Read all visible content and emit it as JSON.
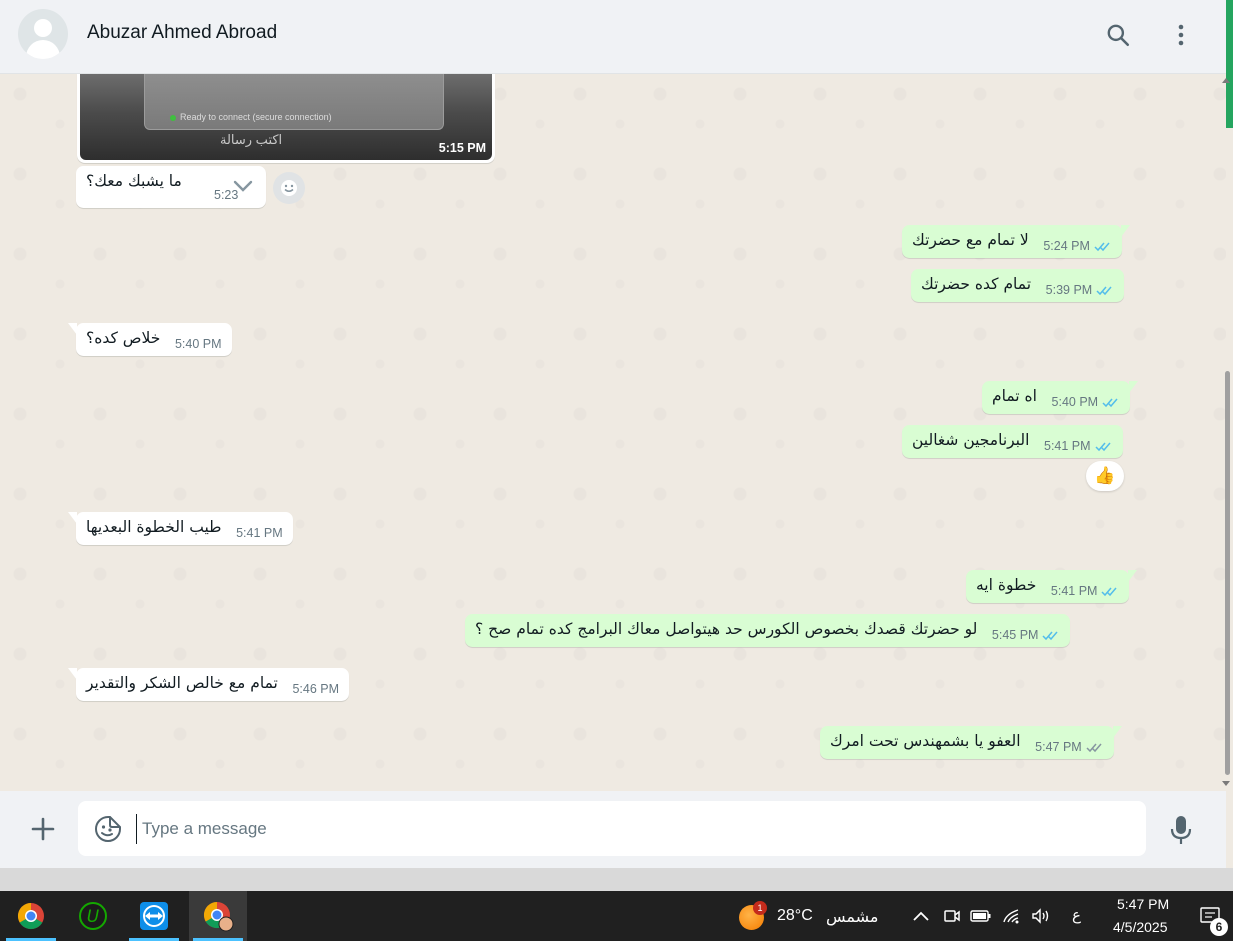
{
  "header": {
    "contact_name": "Abuzar Ahmed Abroad",
    "search_icon": "search-icon",
    "menu_icon": "more-vertical-icon"
  },
  "image_message": {
    "card_text": "Ready to connect (secure connection)",
    "bottom_text": "اكتب رسالة",
    "time": "5:15 PM"
  },
  "messages": [
    {
      "direction": "in",
      "text": "ما يشبك معك؟",
      "time": "5:23"
    },
    {
      "direction": "out",
      "text": "لا تمام مع حضرتك",
      "time": "5:24 PM",
      "status": "read"
    },
    {
      "direction": "out",
      "text": "تمام كده حضرتك",
      "time": "5:39 PM",
      "status": "read"
    },
    {
      "direction": "in",
      "text": "خلاص كده؟",
      "time": "5:40 PM"
    },
    {
      "direction": "out",
      "text": "اه تمام",
      "time": "5:40 PM",
      "status": "read"
    },
    {
      "direction": "out",
      "text": "البرنامجين شغالين",
      "time": "5:41 PM",
      "status": "read",
      "reaction": "👍"
    },
    {
      "direction": "in",
      "text": "طيب الخطوة البعديها",
      "time": "5:41 PM"
    },
    {
      "direction": "out",
      "text": "خطوة ايه",
      "time": "5:41 PM",
      "status": "read"
    },
    {
      "direction": "out",
      "text": "لو حضرتك قصدك بخصوص الكورس حد هيتواصل معاك البرامج كده تمام صح ؟",
      "time": "5:45 PM",
      "status": "read"
    },
    {
      "direction": "in",
      "text": "تمام مع خالص الشكر والتقدير",
      "time": "5:46 PM"
    },
    {
      "direction": "out",
      "text": "العفو يا بشمهندس تحت امرك",
      "time": "5:47 PM",
      "status": "delivered"
    }
  ],
  "composer": {
    "placeholder": "Type a message",
    "attach_icon": "plus-icon",
    "sticker_icon": "sticker-icon",
    "mic_icon": "microphone-icon"
  },
  "colors": {
    "incoming_bubble": "#ffffff",
    "outgoing_bubble": "#d9fdd3",
    "read_tick": "#53bdeb",
    "delivered_tick": "#8696a0",
    "chat_background": "#efeae2"
  },
  "taskbar": {
    "apps": [
      "chrome-icon",
      "upwork-icon",
      "teamviewer-icon",
      "chrome-profile-icon"
    ],
    "weather_badge": "1",
    "temperature": "28°C",
    "weather_desc": "مشمس",
    "language": "ع",
    "time": "5:47 PM",
    "date": "4/5/2025",
    "notification_count": "6"
  }
}
